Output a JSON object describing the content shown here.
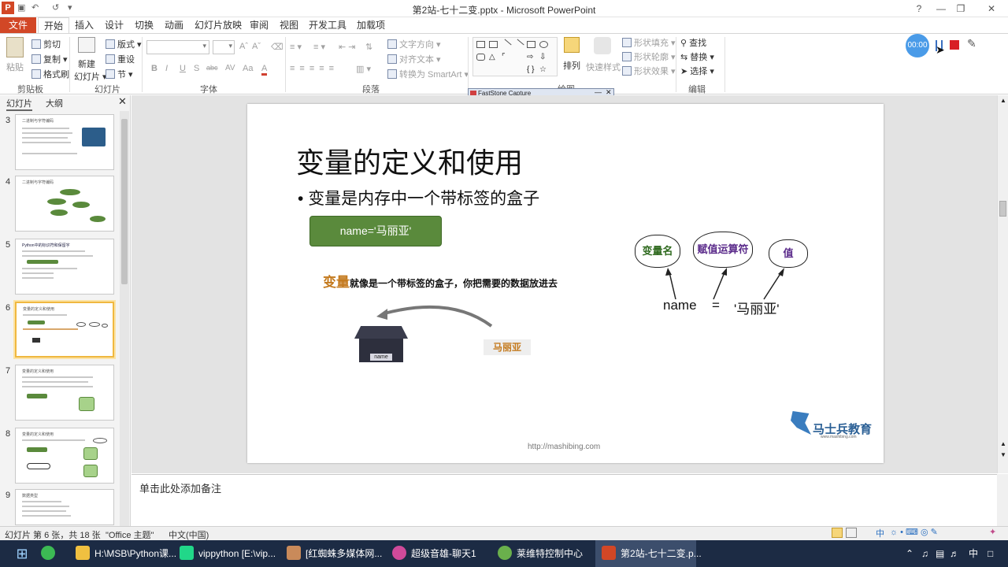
{
  "window": {
    "title": "第2站-七十二变.pptx - Microsoft PowerPoint",
    "app_badge": "P"
  },
  "tabs": [
    "文件",
    "开始",
    "插入",
    "设计",
    "切换",
    "动画",
    "幻灯片放映",
    "审阅",
    "视图",
    "开发工具",
    "加载项"
  ],
  "ribbon": {
    "clipboard": {
      "paste": "粘贴",
      "cut": "剪切",
      "copy": "复制",
      "format_painter": "格式刷",
      "label": "剪贴板"
    },
    "slides": {
      "new_slide_1": "新建",
      "new_slide_2": "幻灯片",
      "layout": "版式",
      "reset": "重设",
      "section": "节",
      "label": "幻灯片"
    },
    "font": {
      "label": "字体",
      "bold": "B",
      "italic": "I",
      "underline": "U",
      "shadow": "S",
      "strike": "abc",
      "spacing": "AV",
      "case": "Aa",
      "color": "A"
    },
    "paragraph": {
      "text_direction": "文字方向",
      "align_text": "对齐文本",
      "convert_smartart": "转换为 SmartArt",
      "label": "段落"
    },
    "drawing": {
      "arrange": "排列",
      "quick_styles": "快速样式",
      "shape_fill": "形状填充",
      "shape_outline": "形状轮廓",
      "shape_effects": "形状效果",
      "label": "绘图"
    },
    "editing": {
      "find": "查找",
      "replace": "替换",
      "select": "选择",
      "label": "编辑"
    }
  },
  "recorder": {
    "time": "00:00"
  },
  "faststone": {
    "title": "FastStone Capture"
  },
  "panel": {
    "tab_slides": "幻灯片",
    "tab_outline": "大纲",
    "thumbs": [
      {
        "num": "3",
        "title": "二进制与字符编码"
      },
      {
        "num": "4",
        "title": "二进制与字符编码"
      },
      {
        "num": "5",
        "title": "Python中的标识符和保留字"
      },
      {
        "num": "6",
        "title": "变量的定义和使用"
      },
      {
        "num": "7",
        "title": "变量的定义和使用"
      },
      {
        "num": "8",
        "title": "变量的定义和使用"
      },
      {
        "num": "9",
        "title": "数据类型"
      }
    ]
  },
  "slide": {
    "title": "变量的定义和使用",
    "bullet": "变量是内存中一个带标签的盒子",
    "green_box": "name='马丽亚'",
    "caption_highlight": "变量",
    "caption_rest": "就像是一个带标签的盒子，你把需要的数据放进去",
    "box_label": "name",
    "value_tag": "马丽亚",
    "cloud_var": "变量名",
    "cloud_op": "赋值运算符",
    "cloud_val": "值",
    "eq_name": "name",
    "eq_sign": "=",
    "eq_value": "'马丽亚'",
    "logo": "马士兵教育",
    "logo_sub": "www.mashibing.com",
    "footer_url": "http://mashibing.com"
  },
  "notes_placeholder": "单击此处添加备注",
  "status": {
    "slide_info": "幻灯片 第 6 张，共 18 张",
    "theme": "\"Office 主题\"",
    "language": "中文(中国)"
  },
  "taskbar": [
    {
      "label": "H:\\MSB\\Python课..."
    },
    {
      "label": "vippython [E:\\vip..."
    },
    {
      "label": "[红蜘蛛多媒体网..."
    },
    {
      "label": "超级音雄-聊天1"
    },
    {
      "label": "莱维特控制中心"
    },
    {
      "label": "第2站-七十二变.p..."
    }
  ],
  "tray": {
    "ime": "中",
    "ime_status": "中"
  },
  "colors": {
    "file_tab": "#d24726",
    "green_box": "#5a8a3c",
    "highlight": "#c47a1e",
    "taskbar": "#1c2b44"
  }
}
